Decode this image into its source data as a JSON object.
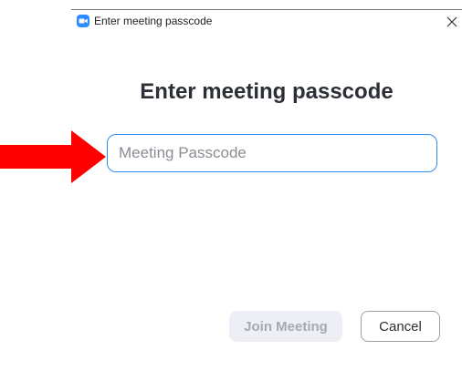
{
  "window": {
    "title": "Enter meeting passcode",
    "app_icon": "zoom-camera-icon",
    "close_icon": "close-icon"
  },
  "dialog": {
    "heading": "Enter meeting passcode",
    "passcode_input": {
      "placeholder": "Meeting Passcode",
      "value": ""
    },
    "join_button_label": "Join Meeting",
    "cancel_button_label": "Cancel"
  },
  "annotation": {
    "icon": "red-arrow-icon",
    "color": "#ff0000"
  },
  "colors": {
    "accent": "#2d8cff",
    "heading_text": "#2c2f35",
    "disabled_button_bg": "#eeeff4",
    "disabled_button_text": "#a6a9b0"
  }
}
